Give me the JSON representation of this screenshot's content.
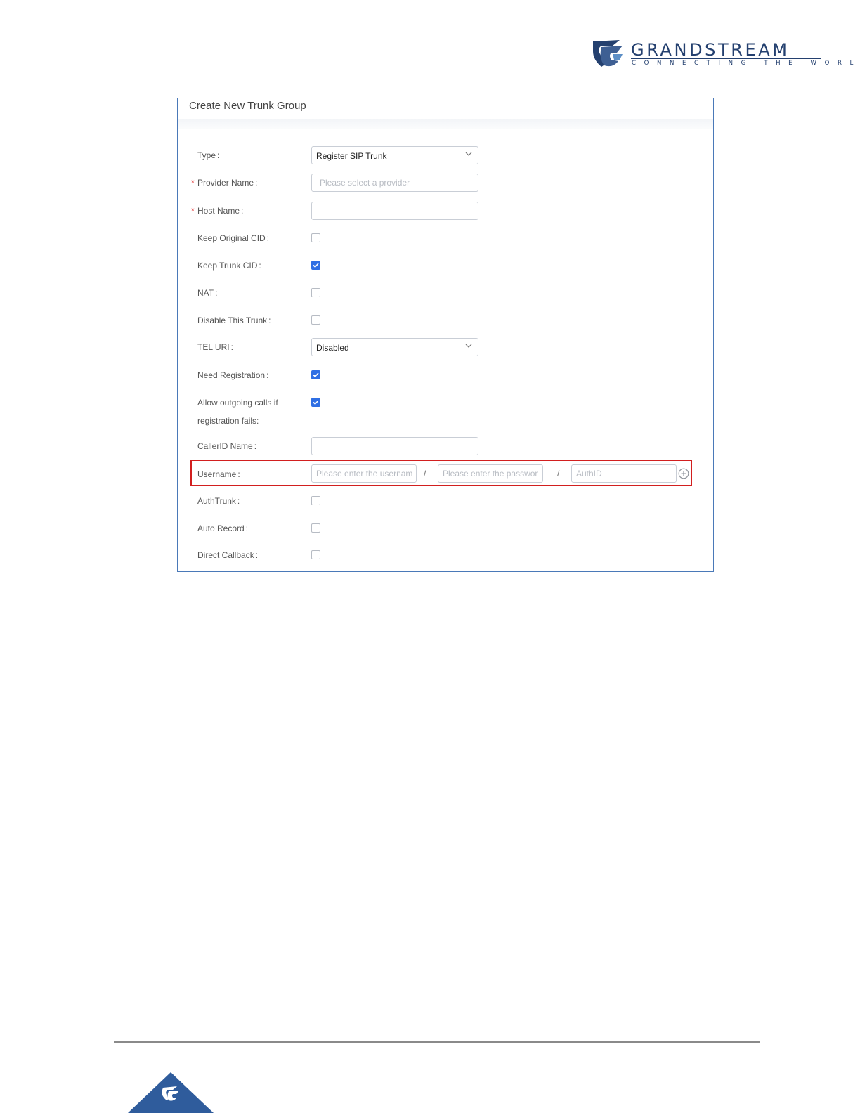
{
  "brand": {
    "name": "GRANDSTREAM",
    "tagline": "CONNECTING THE WORLD",
    "color": "#24406f"
  },
  "dialog": {
    "title": "Create New Trunk Group",
    "accent": "#2f6fe4",
    "fields": {
      "type": {
        "label": "Type",
        "value": "Register SIP Trunk"
      },
      "provider_name": {
        "label": "Provider Name",
        "required": true,
        "placeholder": "Please select a provider"
      },
      "host_name": {
        "label": "Host Name",
        "required": true,
        "value": ""
      },
      "keep_original_cid": {
        "label": "Keep Original CID",
        "checked": false
      },
      "keep_trunk_cid": {
        "label": "Keep Trunk CID",
        "checked": true
      },
      "nat": {
        "label": "NAT",
        "checked": false
      },
      "disable_this_trunk": {
        "label": "Disable This Trunk",
        "checked": false
      },
      "tel_uri": {
        "label": "TEL URI",
        "value": "Disabled"
      },
      "need_registration": {
        "label": "Need Registration",
        "checked": true
      },
      "allow_outgoing": {
        "label_line1": "Allow outgoing calls if",
        "label_line2": "registration fails",
        "checked": true
      },
      "callerid_name": {
        "label": "CallerID Name",
        "value": ""
      },
      "credentials": {
        "label": "Username",
        "username_placeholder": "Please enter the usernam",
        "password_placeholder": "Please enter the passwon",
        "authid_placeholder": "AuthID",
        "separator": "/"
      },
      "auth_trunk": {
        "label": "AuthTrunk",
        "checked": false
      },
      "auto_record": {
        "label": "Auto Record",
        "checked": false
      },
      "direct_callback": {
        "label": "Direct Callback",
        "checked": false
      }
    },
    "colon": ":"
  }
}
